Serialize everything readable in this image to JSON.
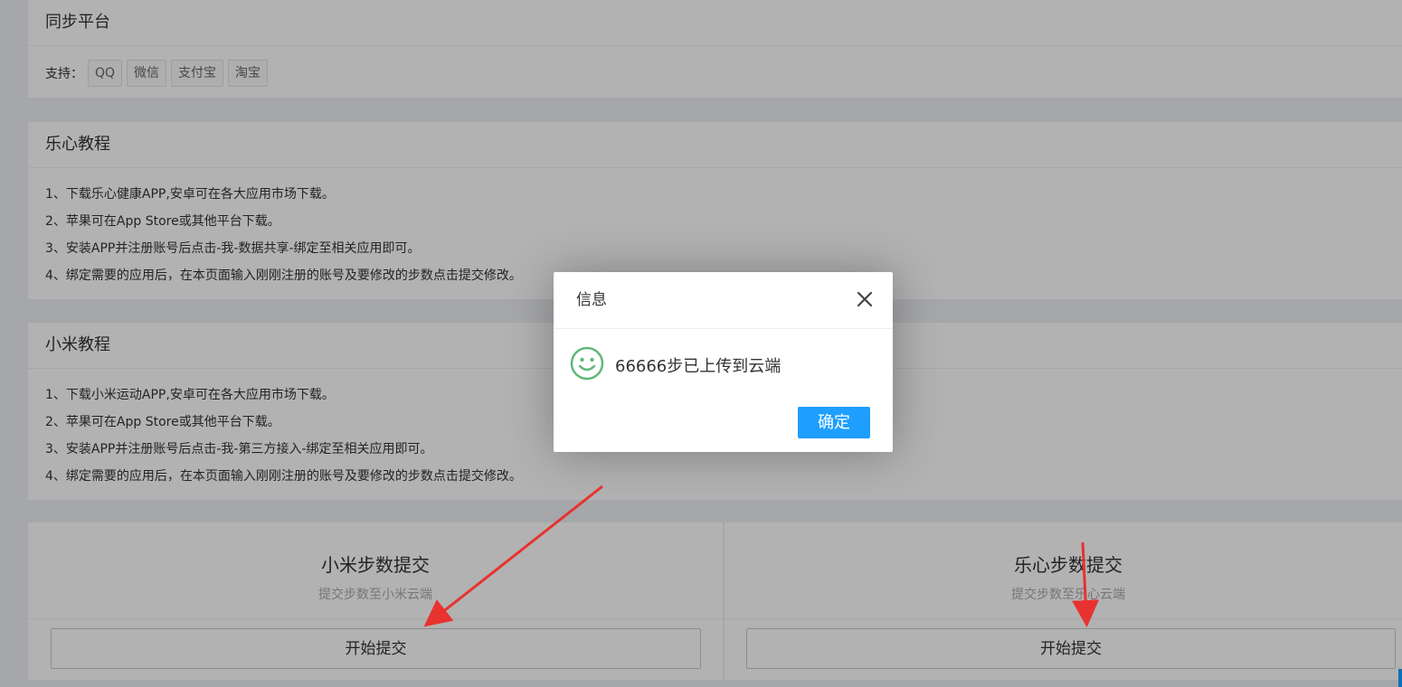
{
  "sync_platform": {
    "title": "同步平台",
    "support_label": "支持：",
    "platforms": [
      "QQ",
      "微信",
      "支付宝",
      "淘宝"
    ]
  },
  "lexin_tutorial": {
    "title": "乐心教程",
    "steps": [
      "1、下载乐心健康APP,安卓可在各大应用市场下载。",
      "2、苹果可在App Store或其他平台下载。",
      "3、安装APP并注册账号后点击-我-数据共享-绑定至相关应用即可。",
      "4、绑定需要的应用后，在本页面输入刚刚注册的账号及要修改的步数点击提交修改。"
    ]
  },
  "xiaomi_tutorial": {
    "title": "小米教程",
    "steps": [
      "1、下载小米运动APP,安卓可在各大应用市场下载。",
      "2、苹果可在App Store或其他平台下载。",
      "3、安装APP并注册账号后点击-我-第三方接入-绑定至相关应用即可。",
      "4、绑定需要的应用后，在本页面输入刚刚注册的账号及要修改的步数点击提交修改。"
    ]
  },
  "xiaomi_submit": {
    "title": "小米步数提交",
    "subtitle": "提交步数至小米云端",
    "button": "开始提交"
  },
  "lexin_submit": {
    "title": "乐心步数提交",
    "subtitle": "提交步数至乐心云端",
    "button": "开始提交"
  },
  "dialog": {
    "title": "信息",
    "message": "66666步已上传到云端",
    "ok_label": "确定",
    "icon": "smile-icon",
    "close_icon": "close-icon"
  },
  "colors": {
    "accent": "#1e9fff",
    "smile": "#5fb878",
    "arrow": "#e8322f"
  }
}
